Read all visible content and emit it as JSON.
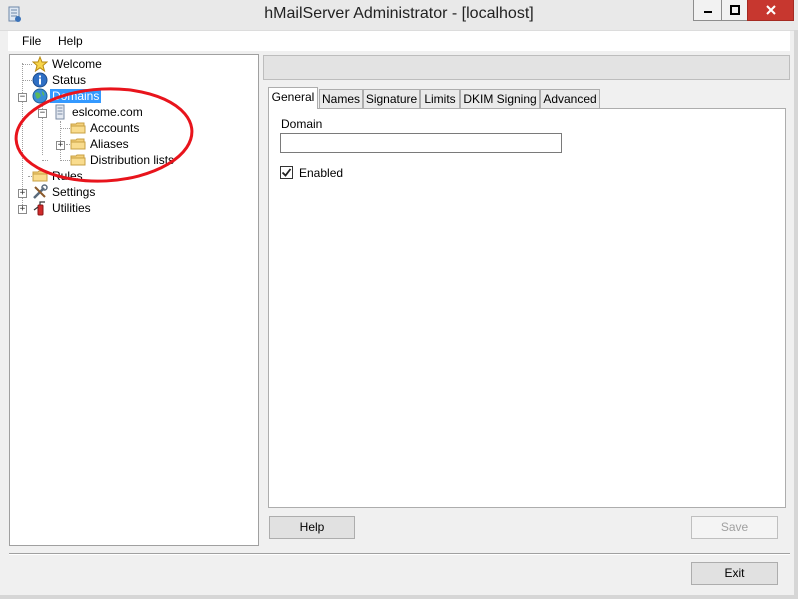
{
  "window": {
    "title": "hMailServer Administrator - [localhost]"
  },
  "menu": {
    "items": [
      "File",
      "Help"
    ]
  },
  "tree": {
    "welcome": "Welcome",
    "status": "Status",
    "domains": "Domains",
    "domain_name": "eslcome.com",
    "accounts": "Accounts",
    "aliases": "Aliases",
    "distribution_lists": "Distribution lists",
    "rules": "Rules",
    "settings": "Settings",
    "utilities": "Utilities"
  },
  "tabs": [
    "General",
    "Names",
    "Signature",
    "Limits",
    "DKIM Signing",
    "Advanced"
  ],
  "general": {
    "domain_label": "Domain",
    "domain_value": "",
    "enabled_label": "Enabled",
    "enabled_checked": true
  },
  "buttons": {
    "help": "Help",
    "save": "Save",
    "exit": "Exit"
  },
  "colors": {
    "selection": "#3399ff",
    "annotation": "#e8141c",
    "close_button": "#c7372f"
  }
}
